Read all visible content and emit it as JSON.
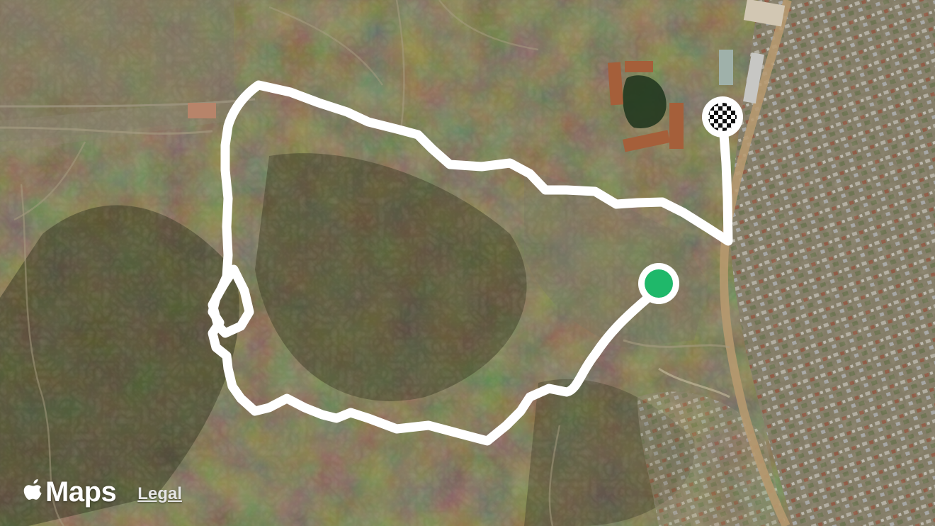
{
  "map": {
    "view": "satellite",
    "route_color": "#ffffff",
    "start_marker_color": "#1fb86a",
    "finish_marker_pattern": "checkered"
  },
  "attribution": {
    "brand_label": "Maps",
    "brand_icon": "apple-logo-icon",
    "legal_label": "Legal"
  }
}
